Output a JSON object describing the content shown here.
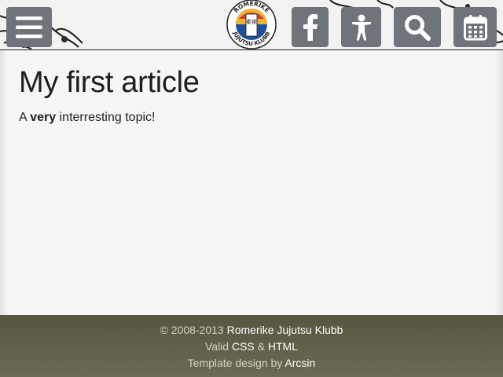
{
  "header": {
    "menu_icon": "hamburger-menu-icon",
    "logo": {
      "top_text": "ROMERIKE",
      "bottom_text": "JUJUTSU KLUBB",
      "center_text": "柔術"
    },
    "buttons": [
      {
        "name": "facebook-icon"
      },
      {
        "name": "accessibility-icon"
      },
      {
        "name": "search-icon"
      },
      {
        "name": "calendar-icon"
      }
    ]
  },
  "article": {
    "title": "My first article",
    "intro_pre": "A",
    "intro_bold": "very",
    "intro_post": "interresting topic!"
  },
  "footer": {
    "copyright_prefix": "© 2008-2013",
    "club_name": "Romerike Jujutsu Klubb",
    "valid_prefix": "Valid",
    "css_link": "CSS",
    "amp": "&",
    "html_link": "HTML",
    "template_prefix": "Template design by",
    "designer_link": "Arcsin"
  },
  "colors": {
    "button_bg": "#6f737a",
    "footer_bg": "#5f5e48",
    "page_bg": "#f6f6f6"
  }
}
